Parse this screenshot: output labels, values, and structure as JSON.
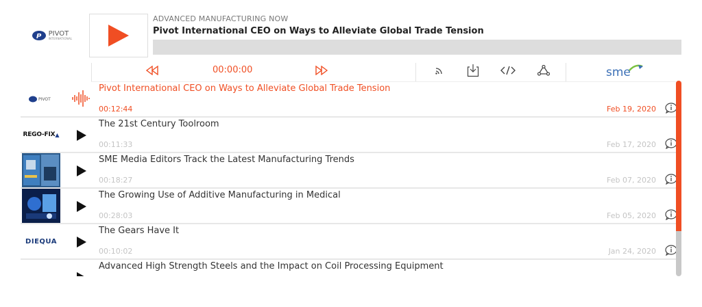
{
  "player": {
    "show_name": "ADVANCED MANUFACTURING NOW",
    "episode_title": "Pivot International CEO on Ways to Alleviate Global Trade Tension",
    "current_time": "00:00:00",
    "logo_text": "PIVOT",
    "logo_subtext": "INTERNATIONAL",
    "progress": 0,
    "accent_color": "#f04e23"
  },
  "controls": {
    "icons": [
      "rewind-icon",
      "fast-forward-icon",
      "rss-icon",
      "download-icon",
      "embed-icon",
      "share-icon"
    ],
    "brand": "sme"
  },
  "episodes": [
    {
      "title": "Pivot International CEO on Ways to Alleviate Global Trade Tension",
      "duration": "00:12:44",
      "date": "Feb 19, 2020",
      "thumb": "PIVOT",
      "playing": true
    },
    {
      "title": "The 21st Century Toolroom",
      "duration": "00:11:33",
      "date": "Feb 17, 2020",
      "thumb": "REGO-FIX"
    },
    {
      "title": "SME Media Editors Track the Latest Manufacturing Trends",
      "duration": "00:18:27",
      "date": "Feb 07, 2020",
      "thumb": "magazine"
    },
    {
      "title": "The Growing Use of Additive Manufacturing in Medical",
      "duration": "00:28:03",
      "date": "Feb 05, 2020",
      "thumb": "medical"
    },
    {
      "title": "The Gears Have It",
      "duration": "00:10:02",
      "date": "Jan 24, 2020",
      "thumb": "DIEQUA"
    },
    {
      "title": "Advanced High Strength Steels and the Impact on Coil Processing Equipment",
      "duration": "",
      "date": "",
      "thumb": "steel"
    }
  ]
}
